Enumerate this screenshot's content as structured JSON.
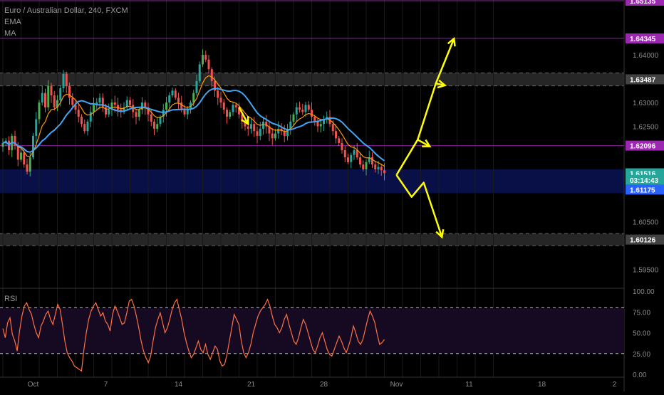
{
  "header": {
    "symbol": "Euro / Australian Dollar, 240, FXCM",
    "ema_label": "EMA",
    "ma_label": "MA"
  },
  "rsi": {
    "label": "RSI",
    "axis_ticks": [
      "100.00",
      "75.00",
      "50.00",
      "25.00",
      "0.00"
    ],
    "tick_values": [
      100,
      75,
      50,
      25,
      0
    ],
    "overbought": 80,
    "oversold": 25,
    "range": [
      0,
      100
    ],
    "values": [
      55,
      44,
      62,
      68,
      48,
      40,
      28,
      52,
      70,
      82,
      86,
      78,
      72,
      60,
      50,
      44,
      58,
      64,
      72,
      76,
      66,
      60,
      72,
      84,
      78,
      60,
      40,
      26,
      20,
      16,
      10,
      8,
      6,
      4,
      30,
      50,
      66,
      76,
      82,
      86,
      78,
      70,
      74,
      64,
      60,
      52,
      72,
      82,
      76,
      68,
      60,
      62,
      74,
      88,
      90,
      82,
      70,
      56,
      40,
      28,
      20,
      14,
      22,
      40,
      56,
      66,
      74,
      62,
      50,
      56,
      66,
      78,
      86,
      90,
      78,
      66,
      50,
      38,
      28,
      20,
      24,
      32,
      40,
      30,
      26,
      36,
      24,
      18,
      26,
      34,
      30,
      16,
      10,
      12,
      24,
      40,
      56,
      72,
      66,
      60,
      40,
      26,
      20,
      26,
      36,
      50,
      60,
      70,
      76,
      80,
      84,
      90,
      82,
      70,
      60,
      56,
      50,
      56,
      66,
      72,
      60,
      50,
      40,
      36,
      44,
      56,
      66,
      60,
      50,
      40,
      30,
      26,
      34,
      44,
      50,
      40,
      30,
      24,
      22,
      30,
      38,
      46,
      40,
      32,
      26,
      34,
      44,
      58,
      50,
      40,
      36,
      42,
      54,
      66,
      76,
      70,
      62,
      48,
      36,
      38,
      42
    ]
  },
  "chart_data": {
    "type": "candlestick",
    "symbol": "Euro / Australian Dollar",
    "timeframe": "240",
    "source": "FXCM",
    "indicators": [
      "EMA",
      "MA",
      "RSI"
    ],
    "y_axis": {
      "range": [
        1.5915,
        1.6515
      ],
      "ticks": [
        "1.64000",
        "1.63000",
        "1.62500",
        "1.60500",
        "1.59500"
      ],
      "tick_values": [
        1.64,
        1.63,
        1.625,
        1.605,
        1.595
      ]
    },
    "x_axis": {
      "ticks": [
        "Oct",
        "7",
        "14",
        "21",
        "28",
        "Nov",
        "11",
        "18",
        "2"
      ],
      "tick_index": [
        10,
        34,
        58,
        82,
        106,
        130,
        154,
        178,
        202
      ]
    },
    "price_labels": [
      {
        "text": "1.65135",
        "value": 1.65135,
        "color": "#9c27b0"
      },
      {
        "text": "1.64345",
        "value": 1.64345,
        "color": "#9c27b0"
      },
      {
        "text": "1.63487",
        "value": 1.63487,
        "color": "#424242"
      },
      {
        "text": "1.62096",
        "value": 1.62096,
        "color": "#9c27b0"
      },
      {
        "text": "1.61516",
        "value": 1.61516,
        "color": "#26a69a"
      },
      {
        "text": "03:14:43",
        "value": 1.61375,
        "color": "#26a69a"
      },
      {
        "text": "1.61175",
        "value": 1.61175,
        "color": "#2962ff"
      },
      {
        "text": "1.60126",
        "value": 1.60126,
        "color": "#424242"
      }
    ],
    "horizontal_lines": [
      {
        "value": 1.65135,
        "color": "#9c27b0"
      },
      {
        "value": 1.64345,
        "color": "#9c27b0"
      },
      {
        "value": 1.62096,
        "color": "#9c27b0"
      }
    ],
    "zones": [
      {
        "from": 1.6335,
        "to": 1.6362,
        "color": "#2a2a2a"
      },
      {
        "from": 1.6,
        "to": 1.6025,
        "color": "#2a2a2a"
      },
      {
        "from": 1.611,
        "to": 1.616,
        "color": "#0a1250"
      }
    ],
    "series_close": [
      1.6215,
      1.622,
      1.62,
      1.623,
      1.621,
      1.618,
      1.6195,
      1.617,
      1.6155,
      1.6185,
      1.623,
      1.6265,
      1.63,
      1.632,
      1.629,
      1.6335,
      1.6315,
      1.629,
      1.6305,
      1.633,
      1.636,
      1.6335,
      1.631,
      1.6295,
      1.6285,
      1.627,
      1.6255,
      1.624,
      1.626,
      1.628,
      1.6295,
      1.63,
      1.631,
      1.629,
      1.6275,
      1.6285,
      1.63,
      1.6295,
      1.6285,
      1.628,
      1.629,
      1.6305,
      1.6295,
      1.628,
      1.627,
      1.6285,
      1.63,
      1.629,
      1.6275,
      1.626,
      1.6245,
      1.6255,
      1.627,
      1.6285,
      1.63,
      1.6315,
      1.6325,
      1.631,
      1.63,
      1.6285,
      1.6275,
      1.6285,
      1.63,
      1.632,
      1.6345,
      1.638,
      1.64,
      1.639,
      1.637,
      1.6345,
      1.6325,
      1.631,
      1.63,
      1.6285,
      1.627,
      1.628,
      1.6295,
      1.629,
      1.6275,
      1.626,
      1.625,
      1.6245,
      1.6255,
      1.624,
      1.623,
      1.6245,
      1.626,
      1.625,
      1.6235,
      1.6225,
      1.6235,
      1.6245,
      1.624,
      1.623,
      1.6245,
      1.626,
      1.6275,
      1.629,
      1.6285,
      1.628,
      1.6295,
      1.6285,
      1.627,
      1.626,
      1.625,
      1.6255,
      1.6265,
      1.627,
      1.6255,
      1.624,
      1.6225,
      1.6215,
      1.62,
      1.6185,
      1.6175,
      1.619,
      1.62,
      1.6185,
      1.617,
      1.616,
      1.6175,
      1.6185,
      1.617,
      1.616,
      1.6165,
      1.6158,
      1.6152
    ]
  },
  "projection_arrows": [
    {
      "points": [
        [
          130,
          1.6148
        ],
        [
          137,
          1.6222
        ],
        [
          141,
          1.6208
        ]
      ]
    },
    {
      "points": [
        [
          137,
          1.6222
        ],
        [
          143,
          1.634
        ],
        [
          146,
          1.6336
        ]
      ]
    },
    {
      "points": [
        [
          143,
          1.634
        ],
        [
          149,
          1.6434
        ]
      ]
    },
    {
      "points": [
        [
          130,
          1.6148
        ],
        [
          135,
          1.6102
        ],
        [
          139,
          1.6132
        ],
        [
          145,
          1.6018
        ]
      ]
    },
    {
      "points": [
        [
          78,
          1.629
        ],
        [
          81,
          1.6255
        ]
      ]
    }
  ],
  "colors": {
    "bull": "#26a69a",
    "bull_alt": "#4caf50",
    "bear": "#ef5350",
    "ema": "#ff9800",
    "ma": "#42a5f5",
    "rsi": "#ff7043",
    "arrow": "#ffff00",
    "grid": "#1a1a1a",
    "axis_text": "#8a8a8a"
  }
}
